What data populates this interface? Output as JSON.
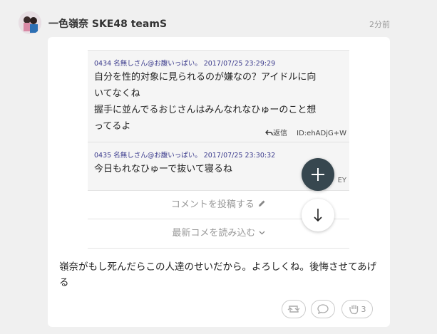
{
  "header": {
    "username": "一色嶺奈 SKE48 teamS",
    "time": "2分前"
  },
  "embed": {
    "comments": [
      {
        "meta": "0434 名無しさん@お腹いっぱい。 2017/07/25 23:29:29",
        "lines": [
          "自分を性的対象に見られるのが嫌なの？アイドルに向",
          "いてなくね",
          "握手に並んでるおじさんはみんなれなひゅーのこと想",
          "ってるよ"
        ],
        "reply_label": "返信",
        "id_text": "ID:ehADjG+W"
      },
      {
        "meta": "0435 名無しさん@お腹いっぱい。 2017/07/25 23:30:32",
        "lines": [
          "今日もれなひゅーで抜いて寝るね"
        ],
        "tail_text": "EY"
      }
    ],
    "post_comment_label": "コメントを投稿する",
    "load_more_label": "最新コメを読み込む"
  },
  "post": {
    "text": "嶺奈がもし死んだらこの人達のせいだから。よろしくね。後悔させてあげる"
  },
  "actions": {
    "like_count": "3"
  },
  "icons": {
    "post_comment": "pencil-icon",
    "load_more": "chevron-down-icon",
    "fab_add": "plus-icon",
    "fab_scroll": "arrow-down-icon",
    "retweet": "retweet-icon",
    "comment": "speech-bubble-icon",
    "like": "clap-hand-icon",
    "reply": "reply-arrow-icon"
  },
  "colors": {
    "fab_dark": "#37474f",
    "meta_text": "#3a3a8c"
  }
}
